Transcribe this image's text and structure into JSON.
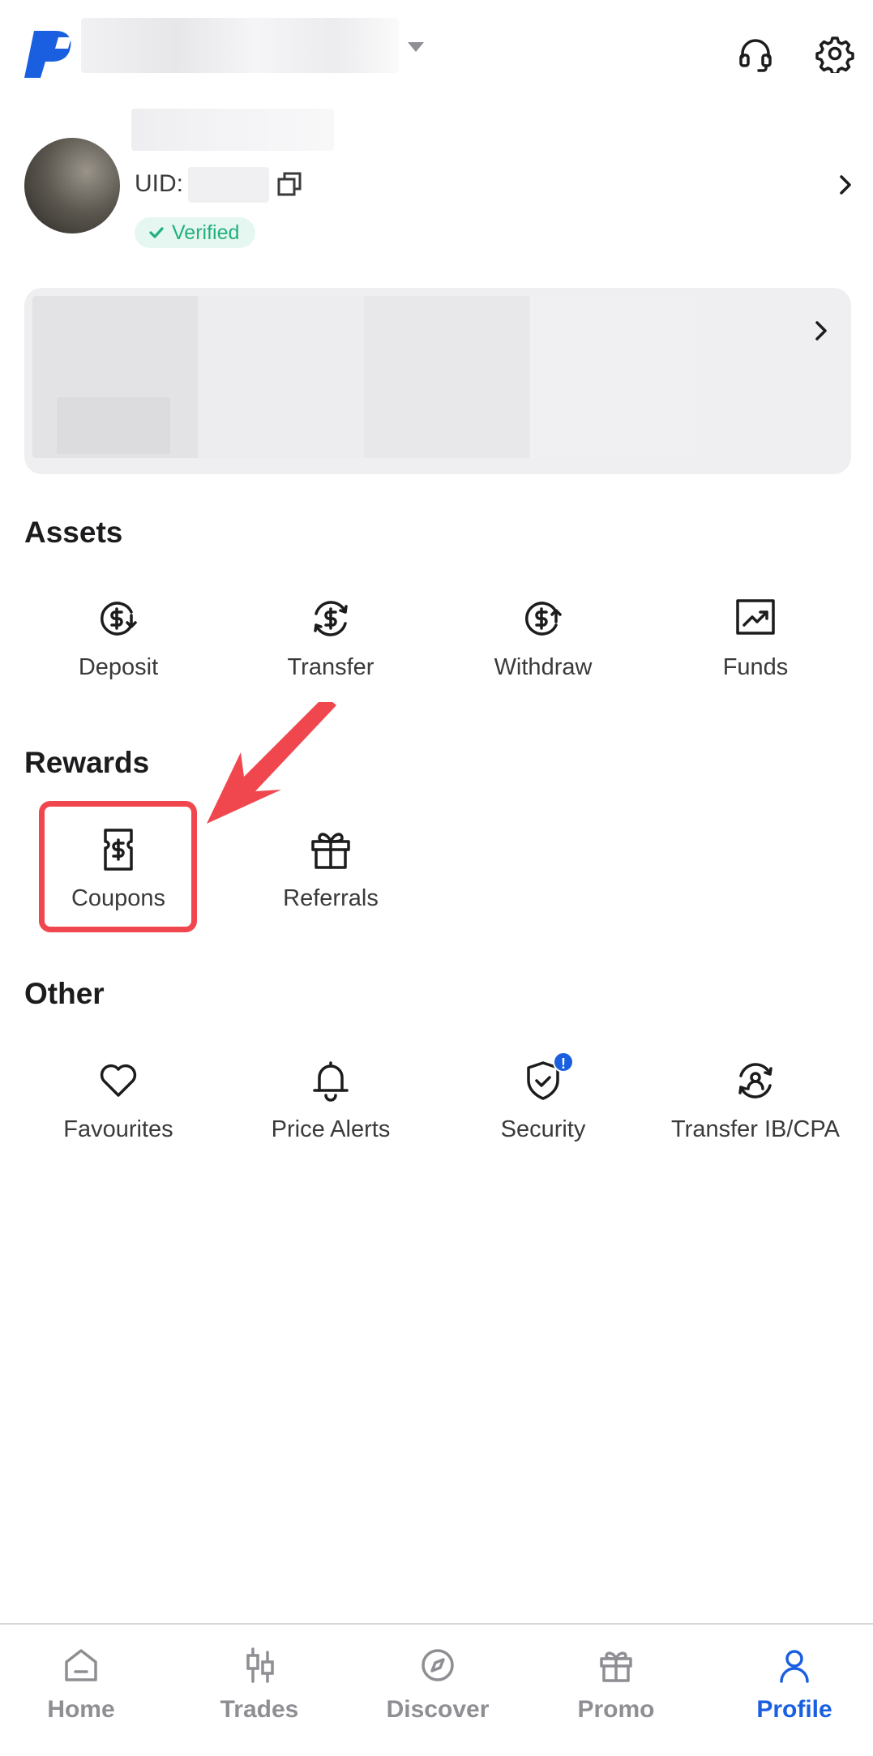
{
  "colors": {
    "brand": "#1a5fe0",
    "verified_text": "#22b07d",
    "verified_bg": "#e6f7f1",
    "highlight": "#f0474f",
    "muted": "#8e8e93"
  },
  "header": {
    "support_icon": "headset-icon",
    "settings_icon": "gear-icon"
  },
  "profile": {
    "uid_label": "UID:",
    "verified_label": "Verified"
  },
  "sections": {
    "assets": {
      "title": "Assets",
      "items": [
        {
          "label": "Deposit",
          "icon": "deposit-icon"
        },
        {
          "label": "Transfer",
          "icon": "transfer-icon"
        },
        {
          "label": "Withdraw",
          "icon": "withdraw-icon"
        },
        {
          "label": "Funds",
          "icon": "chart-up-icon"
        }
      ]
    },
    "rewards": {
      "title": "Rewards",
      "items": [
        {
          "label": "Coupons",
          "icon": "coupon-icon"
        },
        {
          "label": "Referrals",
          "icon": "gift-icon"
        }
      ]
    },
    "other": {
      "title": "Other",
      "items": [
        {
          "label": "Favourites",
          "icon": "heart-icon"
        },
        {
          "label": "Price Alerts",
          "icon": "bell-icon"
        },
        {
          "label": "Security",
          "icon": "shield-icon",
          "badge": "!"
        },
        {
          "label": "Transfer IB/CPA",
          "icon": "user-transfer-icon"
        }
      ]
    }
  },
  "bottom_nav": [
    {
      "label": "Home",
      "icon": "home-icon",
      "active": false
    },
    {
      "label": "Trades",
      "icon": "candlestick-icon",
      "active": false
    },
    {
      "label": "Discover",
      "icon": "compass-icon",
      "active": false
    },
    {
      "label": "Promo",
      "icon": "gift-icon",
      "active": false
    },
    {
      "label": "Profile",
      "icon": "user-icon",
      "active": true
    }
  ]
}
